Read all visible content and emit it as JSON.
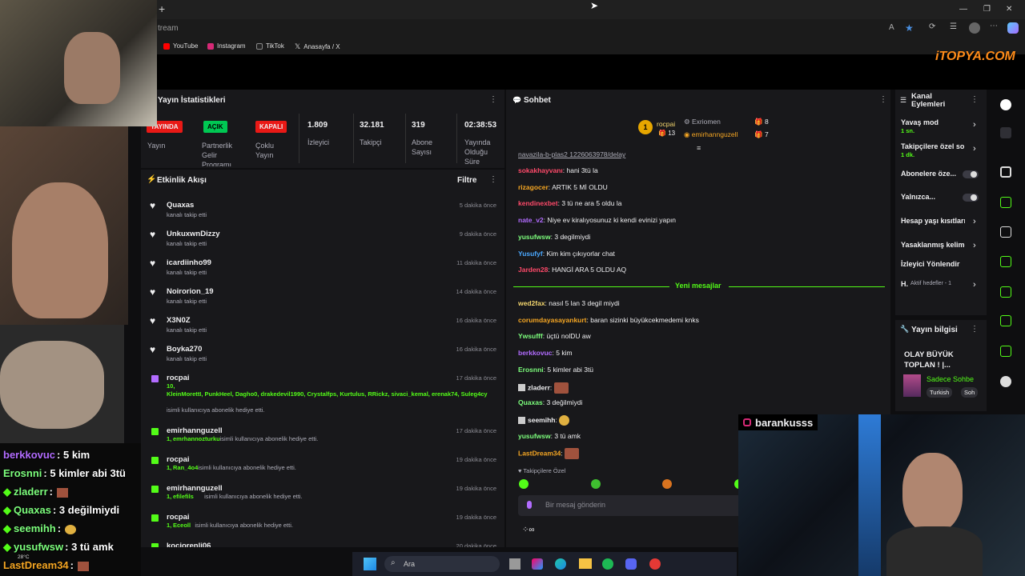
{
  "browser": {
    "url_fragment": "tream",
    "bookmarks": [
      "YouTube",
      "Instagram",
      "TikTok",
      "Anasayfa / X"
    ],
    "watermark": "iTOPYA.COM"
  },
  "stats": {
    "title": "Yayın İstatistikleri",
    "items": [
      {
        "badge": "YAYINDA",
        "label": "Yayın"
      },
      {
        "badge": "AÇIK",
        "label": "Partnerlik Gelir Programı"
      },
      {
        "badge": "KAPALI",
        "label": "Çoklu Yayın"
      },
      {
        "value": "1.809",
        "label": "İzleyici"
      },
      {
        "value": "32.181",
        "label": "Takipçi"
      },
      {
        "value": "319",
        "label": "Abone Sayısı"
      },
      {
        "value": "02:38:53",
        "label": "Yayında Olduğu Süre"
      }
    ]
  },
  "activity": {
    "title": "Etkinlik Akışı",
    "filter": "Filtre",
    "events": [
      {
        "name": "Quaxas",
        "sub": "kanalı takip etti",
        "time": "5 dakika önce",
        "kind": "follow"
      },
      {
        "name": "UnkuxwnDizzy",
        "sub": "kanalı takip etti",
        "time": "9 dakika önce",
        "kind": "follow"
      },
      {
        "name": "icardiinho99",
        "sub": "kanalı takip etti",
        "time": "11 dakika önce",
        "kind": "follow"
      },
      {
        "name": "Noirorion_19",
        "sub": "kanalı takip etti",
        "time": "14 dakika önce",
        "kind": "follow"
      },
      {
        "name": "X3N0Z",
        "sub": "kanalı takip etti",
        "time": "16 dakika önce",
        "kind": "follow"
      },
      {
        "name": "Boyka270",
        "sub": "kanalı takip etti",
        "time": "16 dakika önce",
        "kind": "follow"
      },
      {
        "name": "rocpai",
        "count": "10,",
        "list": "KleinMorettI, PunkHeel, Dagho0, drakedevil1990, Crystalfps, Kurtulus, RRickz, sivaci_kemal, erenak74, Suleg4cy",
        "sub": "isimli kullanıcıya abonelik hediye etti.",
        "time": "17 dakika önce",
        "kind": "gift-purple"
      },
      {
        "name": "emirhannguzell",
        "count": "1,",
        "list": "emrhannozturku",
        "sub": "isimli kullanıcıya abonelik hediye etti.",
        "time": "17 dakika önce",
        "kind": "gift"
      },
      {
        "name": "rocpai",
        "count": "1,",
        "list": "Ran_4o4",
        "sub": "isimli kullanıcıya abonelik hediye etti.",
        "time": "19 dakika önce",
        "kind": "gift"
      },
      {
        "name": "emirhannguzell",
        "count": "1,",
        "list": "efilefils",
        "sub": "isimli kullanıcıya abonelik hediye etti.",
        "time": "19 dakika önce",
        "kind": "gift"
      },
      {
        "name": "rocpai",
        "count": "1,",
        "list": "Eceoll",
        "sub": "isimli kullanıcıya abonelik hediye etti.",
        "time": "19 dakika önce",
        "kind": "gift"
      },
      {
        "name": "kociorenli06",
        "sub": "",
        "time": "20 dakika önce",
        "kind": "gift"
      }
    ]
  },
  "chat": {
    "title": "Sohbet",
    "top_gifters": [
      {
        "rank": "1",
        "name": "rocpai",
        "count": "13"
      },
      {
        "name": "Exriomen",
        "count": "8"
      },
      {
        "name": "emirhannguzell",
        "count": "7"
      }
    ],
    "partial_line": "navazila-b-plas2 1226063978/delay",
    "messages_before": [
      {
        "user": "sokakhayvanı",
        "color": "#ff4a6a",
        "text": "hani 3tü la"
      },
      {
        "user": "rizagocer",
        "color": "#f5a623",
        "text": "ARTIK 5 Mİ OLDU"
      },
      {
        "user": "kendinexbet",
        "color": "#ff4a6a",
        "text": "3 tü ne ara 5 oldu la"
      },
      {
        "user": "nate_v2",
        "color": "#b26cff",
        "text": "Niye ev kiralıyosunuz ki kendi evinizi yapın"
      },
      {
        "user": "yusufwsw",
        "color": "#7dff7d",
        "text": "3 degilmiydi"
      },
      {
        "user": "Yusufyf",
        "color": "#4aa8ff",
        "text": "Kim kim çıkıyorlar chat"
      },
      {
        "user": "Jarden28",
        "color": "#ff4a6a",
        "text": "HANGİ ARA 5 OLDU AQ"
      }
    ],
    "divider": "Yeni mesajlar",
    "messages_after": [
      {
        "user": "wed2fax",
        "color": "#f5d76e",
        "text": "nasıl 5 lan 3 degil miydi"
      },
      {
        "user": "corumdayasayankurt",
        "color": "#f5a623",
        "text": "baran sizinki büyükcekmedemi knks"
      },
      {
        "user": "Ywsufff",
        "color": "#7dff7d",
        "text": "üçtü nolDU aw"
      },
      {
        "user": "berkkovuc",
        "color": "#b26cff",
        "text": "5 kim"
      },
      {
        "user": "Erosnni",
        "color": "#7dff7d",
        "text": "5 kimler abi 3tü"
      },
      {
        "user": "zladerr",
        "color": "#efeff1",
        "text": ""
      },
      {
        "user": "Quaxas",
        "color": "#7dff7d",
        "text": "3 değilmiydi"
      },
      {
        "user": "seemihh",
        "color": "#efeff1",
        "text": ""
      },
      {
        "user": "yusufwsw",
        "color": "#7dff7d",
        "text": "3 tü amk"
      },
      {
        "user": "LastDream34",
        "color": "#f5a623",
        "text": ""
      }
    ],
    "followers_only": "Takipçilere Özel",
    "input_placeholder": "Bir mesaj gönderin"
  },
  "channel_actions": {
    "title": "Kanal Eylemleri",
    "items": [
      {
        "label": "Yavaş mod",
        "sub": "1 sn.",
        "control": "chevron"
      },
      {
        "label": "Takipçilere özel so",
        "sub": "1 dk.",
        "control": "chevron"
      },
      {
        "label": "Abonelere öze...",
        "control": "toggle"
      },
      {
        "label": "Yalnızca...",
        "control": "toggle"
      },
      {
        "label": "Hesap yaşı kısıtları",
        "control": "chevron"
      },
      {
        "label": "Yasaklanmış kelime",
        "control": "chevron"
      },
      {
        "label": "İzleyici Yönlendir",
        "control": "none"
      },
      {
        "label": "H.",
        "sub_inline": "Aktif hedefler - 1",
        "control": "chevron"
      }
    ]
  },
  "stream_info": {
    "title": "Yayın bilgisi",
    "stream_title": "OLAY BÜYÜK TOPLAN ! |...",
    "category": "Sadece Sohbe",
    "tags": [
      "Turkish",
      "Soh"
    ]
  },
  "overlay": {
    "instagram": "barankusss",
    "temp": "28°C",
    "chat": [
      {
        "user": "berkkovuc",
        "color": "#b26cff",
        "text": ": 5 kim"
      },
      {
        "user": "Erosnni",
        "color": "#7dff7d",
        "text": ": 5 kimler abi 3tü"
      },
      {
        "user": "zladerr",
        "color": "#7dff7d",
        "text": ":"
      },
      {
        "user": "Quaxas",
        "color": "#7dff7d",
        "text": ": 3 değilmiydi"
      },
      {
        "user": "seemihh",
        "color": "#7dff7d",
        "text": ":"
      },
      {
        "user": "yusufwsw",
        "color": "#7dff7d",
        "text": ": 3 tü amk"
      },
      {
        "user": "LastDream34",
        "color": "#f5a623",
        "text": ":"
      }
    ]
  },
  "taskbar": {
    "search": "Ara"
  }
}
